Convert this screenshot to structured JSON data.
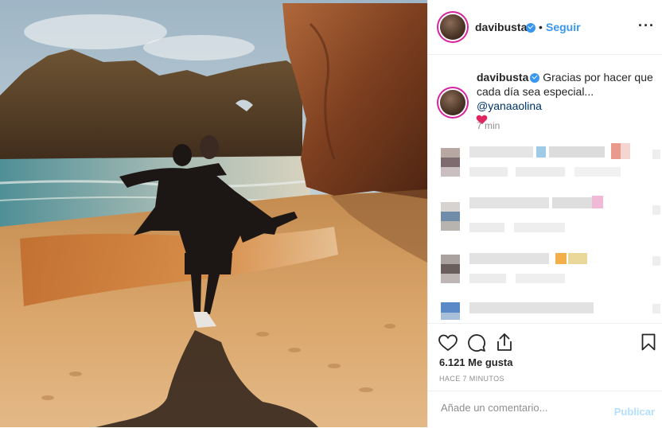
{
  "post": {
    "username": "davibusta",
    "separator": "•",
    "follow_label": "Seguir",
    "more_icon": "···"
  },
  "caption": {
    "username": "davibusta",
    "text": "Gracias por hacer que cada día sea especial...",
    "mention": "@yanaaolina",
    "emoji": "heart",
    "time": "7 min"
  },
  "footer": {
    "likes": "6.121 Me gusta",
    "time_ago": "HACE 7 MINUTOS",
    "comment_placeholder": "Añade un comentario...",
    "publish_label": "Publicar"
  },
  "colors": {
    "accent": "#3897f0",
    "publish_disabled": "#b2dffc",
    "muted": "#8e8e8e",
    "text": "#262626"
  }
}
